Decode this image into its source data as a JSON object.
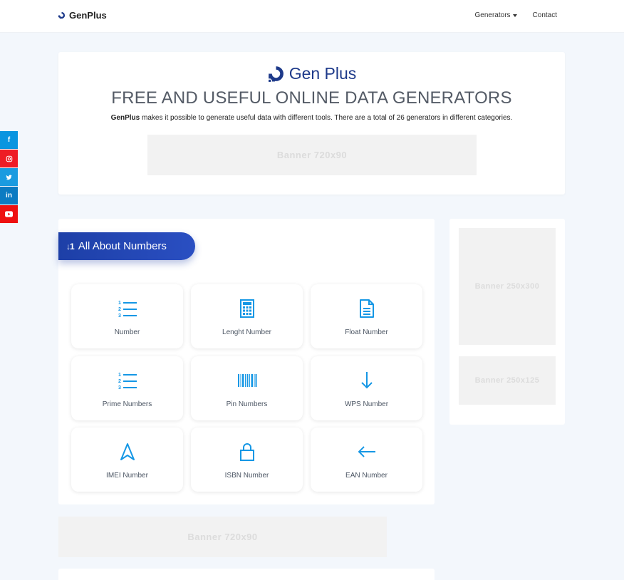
{
  "nav": {
    "brand": "GenPlus",
    "generators": "Generators",
    "contact": "Contact"
  },
  "social": [
    "facebook-icon",
    "instagram-icon",
    "twitter-icon",
    "linkedin-icon",
    "youtube-icon"
  ],
  "hero": {
    "logo_text": "Gen Plus",
    "title": "FREE AND USEFUL ONLINE DATA GENERATORS",
    "desc_strong": "GenPlus",
    "desc_rest": " makes it possible to generate useful data with different tools. There are a total of 26 generators in different categories.",
    "banner": "Banner  720x90"
  },
  "section": {
    "title": "All About Numbers"
  },
  "tiles": [
    {
      "label": "Number",
      "icon": "numbered-list-icon"
    },
    {
      "label": "Lenght Number",
      "icon": "calculator-icon"
    },
    {
      "label": "Float Number",
      "icon": "document-icon"
    },
    {
      "label": "Prime Numbers",
      "icon": "numbered-list-icon"
    },
    {
      "label": "Pin Numbers",
      "icon": "barcode-icon"
    },
    {
      "label": "WPS Number",
      "icon": "arrow-down-icon"
    },
    {
      "label": "IMEI Number",
      "icon": "navigation-arrow-icon"
    },
    {
      "label": "ISBN Number",
      "icon": "lock-icon"
    },
    {
      "label": "EAN Number",
      "icon": "arrow-left-icon"
    }
  ],
  "sidebar": {
    "banner_large": "Banner  250x300",
    "banner_small": "Banner  250x125"
  },
  "bottom_banner": "Banner  720x90",
  "colors": {
    "accent": "#1d3fa7",
    "icon": "#1597e5",
    "background": "#f3f7fc"
  }
}
